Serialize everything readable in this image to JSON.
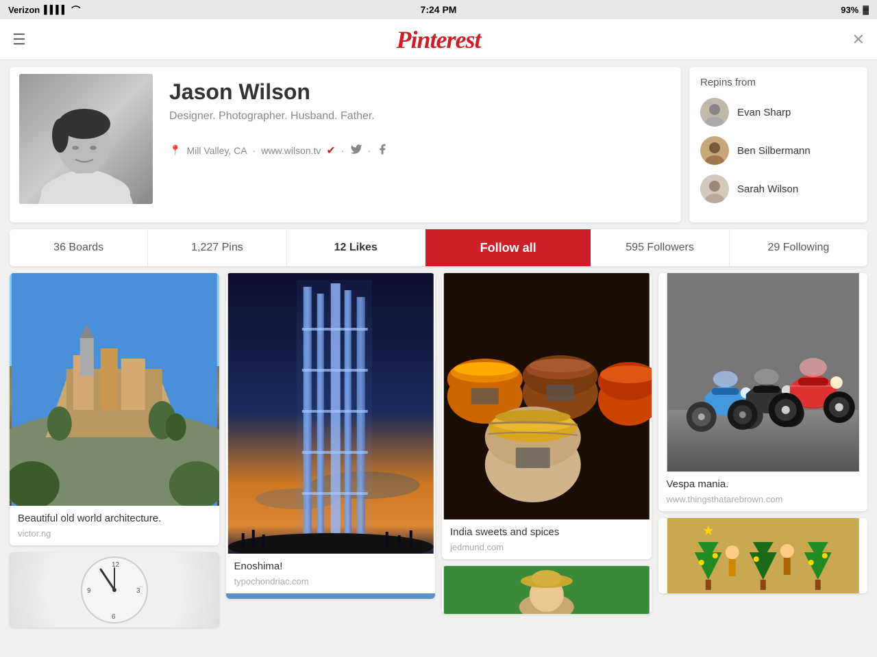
{
  "statusBar": {
    "carrier": "Verizon",
    "time": "7:24 PM",
    "battery": "93%"
  },
  "nav": {
    "title": "Pinterest",
    "menuLabel": "☰",
    "closeLabel": "✕"
  },
  "profile": {
    "name": "Jason Wilson",
    "bio": "Designer. Photographer. Husband. Father.",
    "location": "Mill Valley, CA",
    "website": "www.wilson.tv",
    "avatarAlt": "Jason Wilson profile photo"
  },
  "repins": {
    "title": "Repins from",
    "people": [
      {
        "name": "Evan Sharp"
      },
      {
        "name": "Ben Silbermann"
      },
      {
        "name": "Sarah Wilson"
      }
    ]
  },
  "stats": {
    "boards": "36 Boards",
    "pins": "1,227 Pins",
    "likes": "12 Likes",
    "followAll": "Follow all",
    "followers": "595 Followers",
    "following": "29 Following"
  },
  "pins": [
    {
      "col": 0,
      "title": "Beautiful old world architecture.",
      "source": "victor.ng",
      "imageType": "architecture"
    },
    {
      "col": 0,
      "title": "",
      "source": "",
      "imageType": "clock"
    },
    {
      "col": 1,
      "title": "Enoshima!",
      "source": "typochondriac.com",
      "imageType": "tower"
    },
    {
      "col": 2,
      "title": "India sweets and spices",
      "source": "jedmund.com",
      "imageType": "spices"
    },
    {
      "col": 2,
      "title": "",
      "source": "",
      "imageType": "person"
    },
    {
      "col": 3,
      "title": "Vespa mania.",
      "source": "www.thingsthatarebrown.com",
      "imageType": "vespa"
    },
    {
      "col": 3,
      "title": "",
      "source": "",
      "imageType": "christmas"
    }
  ]
}
